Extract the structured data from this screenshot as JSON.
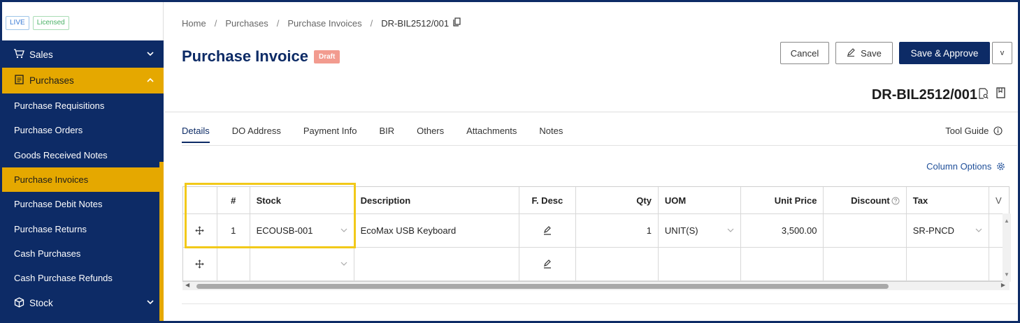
{
  "sidebar": {
    "badges": {
      "live": "LIVE",
      "licensed": "Licensed"
    },
    "sales": {
      "label": "Sales",
      "chevron": "⌄"
    },
    "purchases": {
      "label": "Purchases",
      "chevron": "⌃"
    },
    "sub_items": [
      "Purchase Requisitions",
      "Purchase Orders",
      "Goods Received Notes",
      "Purchase Invoices",
      "Purchase Debit Notes",
      "Purchase Returns",
      "Cash Purchases",
      "Cash Purchase Refunds"
    ],
    "stock": {
      "label": "Stock",
      "chevron": "⌄"
    }
  },
  "breadcrumb": {
    "home": "Home",
    "sep": "/",
    "purchases": "Purchases",
    "invoices": "Purchase Invoices",
    "current": "DR-BIL2512/001"
  },
  "header": {
    "title": "Purchase Invoice",
    "status": "Draft",
    "cancel": "Cancel",
    "save": "Save",
    "approve": "Save & Approve",
    "more": "v",
    "doc_number": "DR-BIL2512/001"
  },
  "tabs": [
    "Details",
    "DO Address",
    "Payment Info",
    "BIR",
    "Others",
    "Attachments",
    "Notes"
  ],
  "tool_guide": "Tool Guide",
  "column_options": "Column Options",
  "grid": {
    "headers": {
      "num": "#",
      "stock": "Stock",
      "description": "Description",
      "fdesc": "F. Desc",
      "qty": "Qty",
      "uom": "UOM",
      "unit_price": "Unit Price",
      "discount": "Discount",
      "tax": "Tax",
      "extra": "V"
    },
    "rows": [
      {
        "num": "1",
        "stock": "ECOUSB-001",
        "description": "EcoMax USB Keyboard",
        "qty": "1",
        "uom": "UNIT(S)",
        "unit_price": "3,500.00",
        "discount": "",
        "tax": "SR-PNCD"
      }
    ]
  },
  "colors": {
    "navy": "#0d2b66",
    "accent": "#e5a800",
    "highlight": "#f2c919",
    "draft": "#f29b8f"
  }
}
